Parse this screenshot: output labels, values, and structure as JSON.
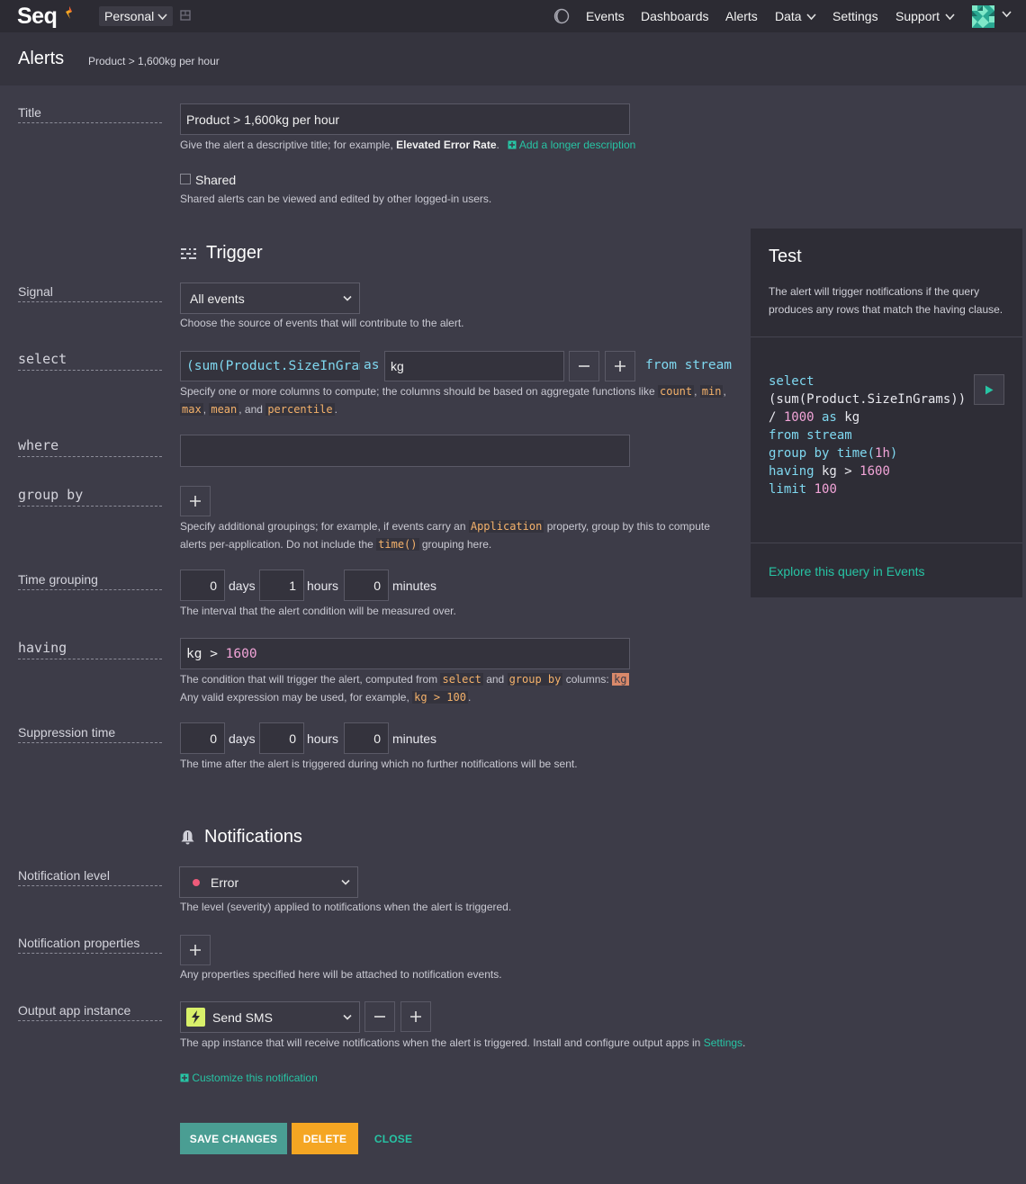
{
  "nav": {
    "logo": "Seq",
    "workspace": "Personal",
    "items": [
      "Events",
      "Dashboards",
      "Alerts",
      "Data",
      "Settings",
      "Support"
    ]
  },
  "header": {
    "title": "Alerts",
    "breadcrumb": "Product > 1,600kg per hour"
  },
  "form": {
    "title": {
      "label": "Title",
      "value": "Product > 1,600kg per hour",
      "help_pre": "Give the alert a descriptive title; for example,",
      "help_example": "Elevated Error Rate",
      "help_post": ".",
      "add_description": "Add a longer description"
    },
    "shared": {
      "label": "Shared",
      "help": "Shared alerts can be viewed and edited by other logged-in users."
    },
    "trigger_heading": "Trigger",
    "signal": {
      "label": "Signal",
      "value": "All events",
      "help": "Choose the source of events that will contribute to the alert."
    },
    "select": {
      "label": "select",
      "expression": "(sum(Product.SizeInGram",
      "as_kw": "as",
      "alias": "kg",
      "from_stream": "from stream",
      "help_pre": "Specify one or more columns to compute; the columns should be based on aggregate functions like",
      "fn_count": "count",
      "fn_min": "min",
      "fn_max": "max",
      "fn_mean": "mean",
      "help_and": ", and",
      "fn_percentile": "percentile",
      "help_end": "."
    },
    "where": {
      "label": "where",
      "value": ""
    },
    "group_by": {
      "label": "group by",
      "help_pre": "Specify additional groupings; for example, if events carry an",
      "help_code": "Application",
      "help_mid": "property, group by this to compute",
      "help_line2_pre": "alerts per-application. Do not include the",
      "help_line2_code": "time()",
      "help_line2_post": "grouping here."
    },
    "time_grouping": {
      "label": "Time grouping",
      "days": "0",
      "hours": "1",
      "minutes": "0",
      "help": "The interval that the alert condition will be measured over."
    },
    "having": {
      "label": "having",
      "lhs": "kg >",
      "rhs": "1600",
      "help_pre": "The condition that will trigger the alert, computed from",
      "help_select": "select",
      "help_and": "and",
      "help_groupby": "group by",
      "help_columns": "columns:",
      "help_tag": "kg",
      "help_line2_pre": "Any valid expression may be used, for example,",
      "help_line2_code": "kg > 100",
      "help_line2_post": "."
    },
    "suppression": {
      "label": "Suppression time",
      "days": "0",
      "hours": "0",
      "minutes": "0",
      "help": "The time after the alert is triggered during which no further notifications will be sent."
    },
    "units": {
      "days": "days",
      "hours": "hours",
      "minutes": "minutes"
    },
    "notifications_heading": "Notifications",
    "notification_level": {
      "label": "Notification level",
      "value": "Error",
      "dot_color": "#ee5b7a",
      "help": "The level (severity) applied to notifications when the alert is triggered."
    },
    "notification_properties": {
      "label": "Notification properties",
      "help": "Any properties specified here will be attached to notification events."
    },
    "output_app": {
      "label": "Output app instance",
      "value": "Send SMS",
      "help_pre": "The app instance that will receive notifications when the alert is triggered. Install and configure output apps in",
      "help_link": "Settings",
      "help_post": "."
    },
    "customize": "Customize this notification"
  },
  "test": {
    "title": "Test",
    "description": "The alert will trigger notifications if the query produces any rows that match the having clause.",
    "explore": "Explore this query in Events",
    "query": {
      "l1": "select",
      "l2_pre": "(sum(Product.SizeInGrams))",
      "l3_op": "/ ",
      "l3_num": "1000",
      "l3_as": " as",
      "l3_alias": " kg",
      "l4_from": "from",
      "l4_stream": " stream",
      "l5_group": "group by",
      "l5_time": " time(",
      "l5_arg": "1h",
      "l5_close": ")",
      "l6_having": "having",
      "l6_expr": " kg > ",
      "l6_num": "1600",
      "l7_limit": "limit",
      "l7_num": " 100"
    }
  },
  "actions": {
    "save": "SAVE CHANGES",
    "delete": "DELETE",
    "close": "CLOSE"
  },
  "colors": {
    "accent": "#27c4a4",
    "save_bg": "#4a9e93",
    "delete_bg": "#f5a623",
    "code": "#f5b26b",
    "number": "#f2a4d8",
    "keyword": "#7fd8f0"
  }
}
